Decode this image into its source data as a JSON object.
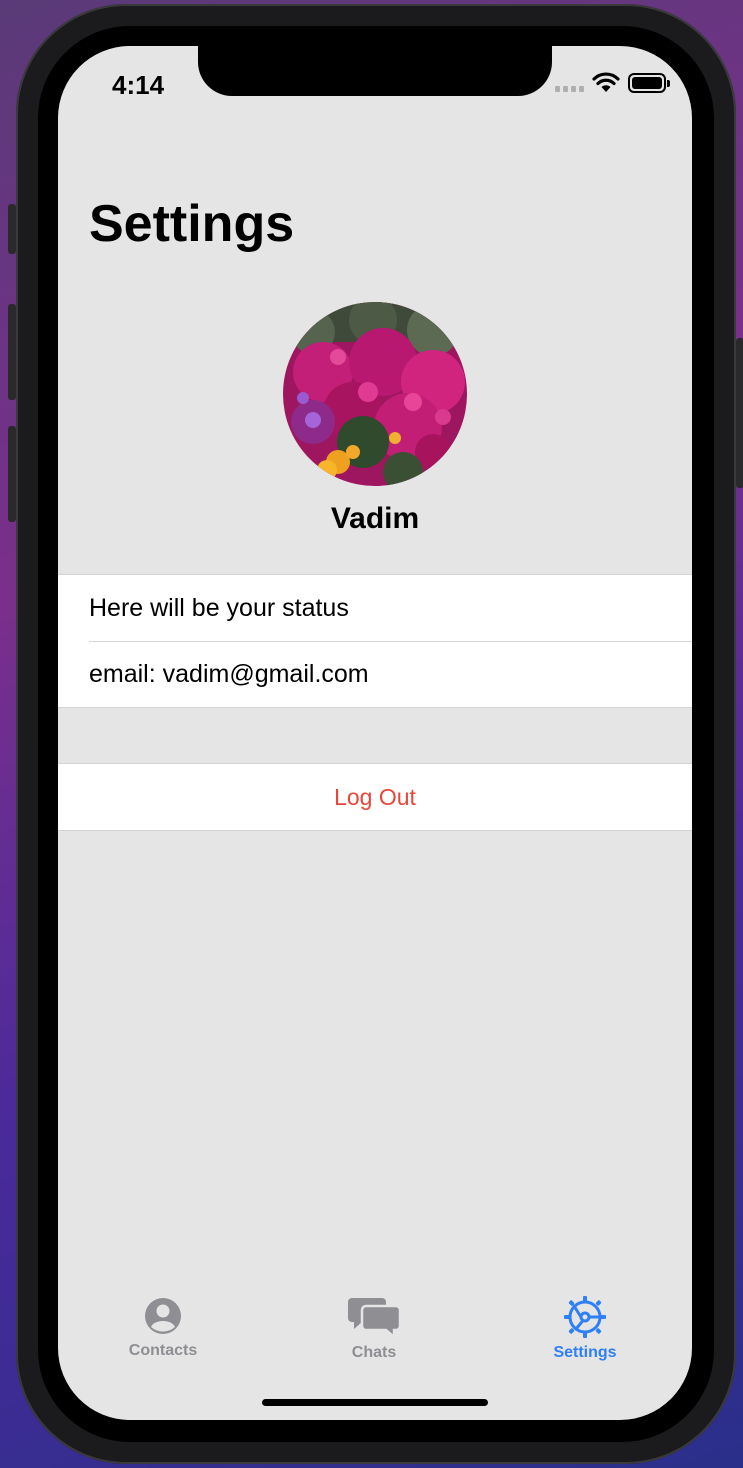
{
  "status_bar": {
    "time": "4:14"
  },
  "page": {
    "title": "Settings"
  },
  "profile": {
    "name": "Vadim"
  },
  "info": {
    "status": "Here will be your status",
    "email": "email: vadim@gmail.com"
  },
  "actions": {
    "logout_label": "Log Out"
  },
  "tabbar": {
    "tabs": [
      {
        "label": "Contacts",
        "icon": "person-circle-icon",
        "color": "#8e8e93"
      },
      {
        "label": "Chats",
        "icon": "chat-bubbles-icon",
        "color": "#8e8e93"
      },
      {
        "label": "Settings",
        "icon": "gear-icon",
        "color": "#2f7ff5"
      }
    ],
    "selected": "Settings"
  },
  "colors": {
    "accent": "#2f7ff5",
    "destructive": "#e8463a",
    "background": "#e5e5e5"
  }
}
